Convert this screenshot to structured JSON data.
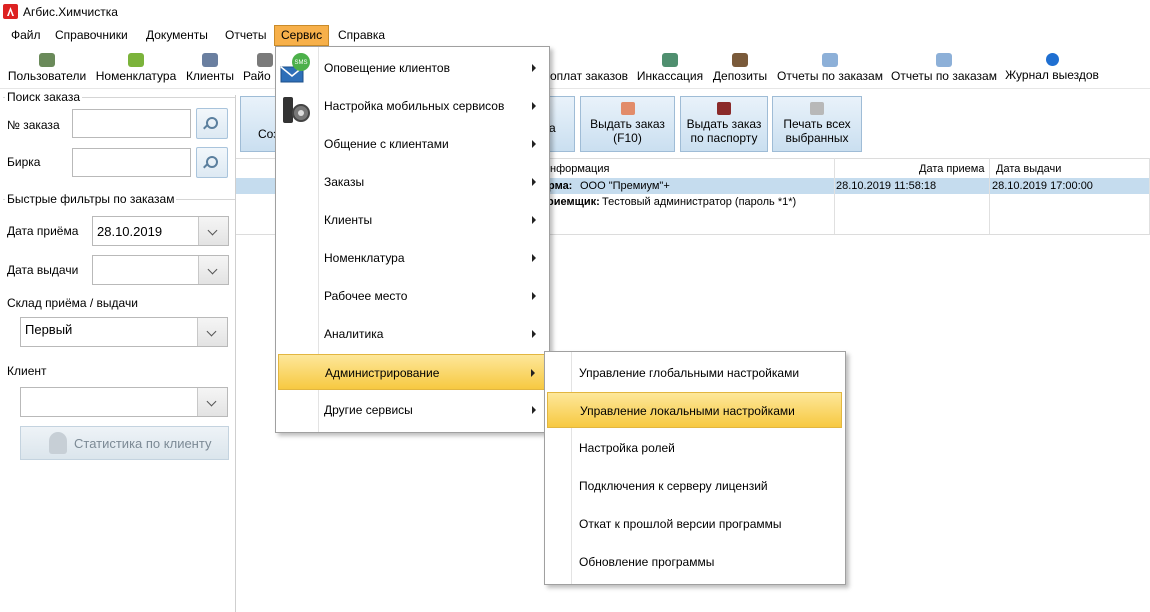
{
  "window": {
    "title": "Агбис.Химчистка"
  },
  "menubar": [
    "Файл",
    "Справочники",
    "Документы",
    "Отчеты",
    "Сервис",
    "Справка"
  ],
  "toolbar": [
    {
      "label": "Пользователи",
      "icon": "users-icon",
      "color": "#6a8a5a"
    },
    {
      "label": "Номенклатура",
      "icon": "nomenclature-icon",
      "color": "#7bb33b"
    },
    {
      "label": "Клиенты",
      "icon": "client-icon",
      "color": "#6a7fa0"
    },
    {
      "label": "Райо",
      "icon": "district-icon",
      "color": "#7a7a7a"
    },
    {
      "label": "оплат заказов",
      "icon": "payments-icon",
      "color": "#8aa0b8"
    },
    {
      "label": "Инкассация",
      "icon": "collection-icon",
      "color": "#4f8f6f"
    },
    {
      "label": "Депозиты",
      "icon": "deposit-icon",
      "color": "#7a5a3a"
    },
    {
      "label": "Отчеты по заказам",
      "icon": "report-icon",
      "color": "#8db0d8"
    },
    {
      "label": "Отчеты по заказам",
      "icon": "report-icon",
      "color": "#8db0d8"
    },
    {
      "label": "Журнал выездов",
      "icon": "arrow-right-icon",
      "color": "#1f6fd1"
    }
  ],
  "left_panel": {
    "search_group": "Поиск заказа",
    "order_no_label": "№ заказа",
    "tag_label": "Бирка",
    "filters_group": "Быстрые фильтры по заказам",
    "received_label": "Дата приёма",
    "received_value": "28.10.2019",
    "issued_label": "Дата выдачи",
    "issued_value": "",
    "warehouse_label": "Склад приёма / выдачи",
    "warehouse_value": "Первый",
    "client_label": "Клиент",
    "client_value": "",
    "stats_button": "Статистика по клиенту"
  },
  "actions": {
    "create_partial": "Соз",
    "hidden_partial": "а",
    "issue_order": [
      "Выдать заказ",
      "(F10)"
    ],
    "issue_passport": [
      "Выдать заказ",
      "по паспорту"
    ],
    "print_selected": [
      "Печать всех",
      "выбранных"
    ]
  },
  "grid": {
    "headers": {
      "info": "нформация",
      "received": "Дата приема",
      "issued": "Дата выдачи"
    },
    "row": {
      "firm_label": "рма:",
      "firm_value": "ООО \"Премиум\"+",
      "receiver_label": "риемщик:",
      "receiver_value": "Тестовый администратор (пароль *1*)",
      "received": "28.10.2019 11:58:18",
      "issued": "28.10.2019 17:00:00"
    }
  },
  "service_menu": [
    "Оповещение клиентов",
    "Настройка мобильных сервисов",
    "Общение с клиентами",
    "Заказы",
    "Клиенты",
    "Номенклатура",
    "Рабочее место",
    "Аналитика",
    "Администрирование",
    "Другие сервисы"
  ],
  "admin_submenu": [
    "Управление глобальными настройками",
    "Управление локальными настройками",
    "Настройка ролей",
    "Подключения к серверу лицензий",
    "Откат к прошлой версии программы",
    "Обновление программы"
  ],
  "colors": {
    "accent": "#f7b04a",
    "highlight": "#f7c941",
    "selected_row": "#c5dcee"
  }
}
